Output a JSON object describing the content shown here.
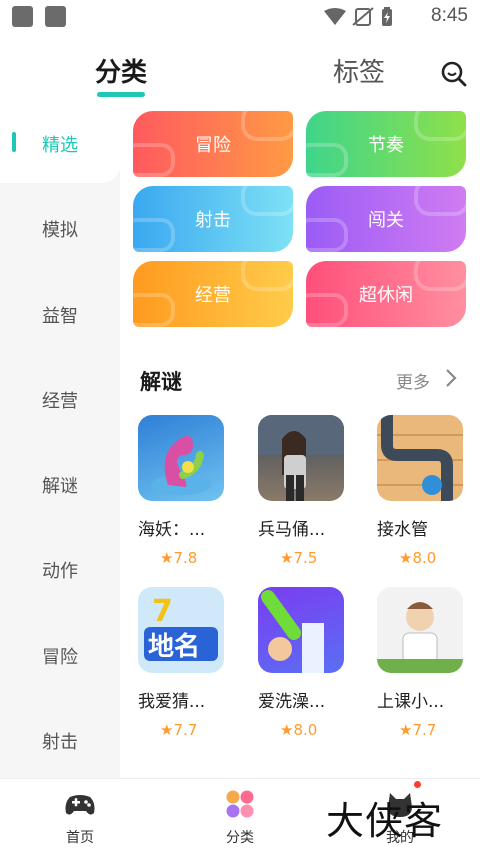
{
  "status_bar": {
    "time": "8:45",
    "icons": [
      "notification-square-icon",
      "notification-square-icon",
      "wifi-icon",
      "no-sim-icon",
      "battery-charging-icon"
    ]
  },
  "top_tabs": {
    "active": "分类",
    "inactive": "标签",
    "accent_color": "#1fc7b4"
  },
  "sidebar": {
    "items": [
      {
        "label": "精选",
        "active": true
      },
      {
        "label": "模拟"
      },
      {
        "label": "益智"
      },
      {
        "label": "经营"
      },
      {
        "label": "解谜"
      },
      {
        "label": "动作"
      },
      {
        "label": "冒险"
      },
      {
        "label": "射击"
      }
    ]
  },
  "categories": [
    {
      "label": "冒险",
      "gradient": [
        "#ff5a5f",
        "#ff9a44"
      ]
    },
    {
      "label": "节奏",
      "gradient": [
        "#3fd58b",
        "#8fe04a"
      ]
    },
    {
      "label": "射击",
      "gradient": [
        "#3aa8f0",
        "#7ee1f5"
      ]
    },
    {
      "label": "闯关",
      "gradient": [
        "#9b5cf5",
        "#d07cf2"
      ]
    },
    {
      "label": "经营",
      "gradient": [
        "#ff9a1f",
        "#ffcc4a"
      ]
    },
    {
      "label": "超休闲",
      "gradient": [
        "#ff4f7a",
        "#ff8fa0"
      ]
    }
  ],
  "section": {
    "title": "解谜",
    "more": "更多"
  },
  "apps": [
    {
      "name": "海妖：...",
      "rating": "7.8"
    },
    {
      "name": "兵马俑...",
      "rating": "7.5"
    },
    {
      "name": "接水管",
      "rating": "8.0"
    },
    {
      "name": "我爱猜...",
      "rating": "7.7"
    },
    {
      "name": "爱洗澡...",
      "rating": "8.0"
    },
    {
      "name": "上课小...",
      "rating": "7.7"
    }
  ],
  "bottom_nav": {
    "items": [
      {
        "label": "首页",
        "icon": "gamepad-icon"
      },
      {
        "label": "分类",
        "icon": "category-icon",
        "active": true
      },
      {
        "label": "我的",
        "icon": "profile-icon"
      }
    ]
  },
  "watermark": "大侠客"
}
